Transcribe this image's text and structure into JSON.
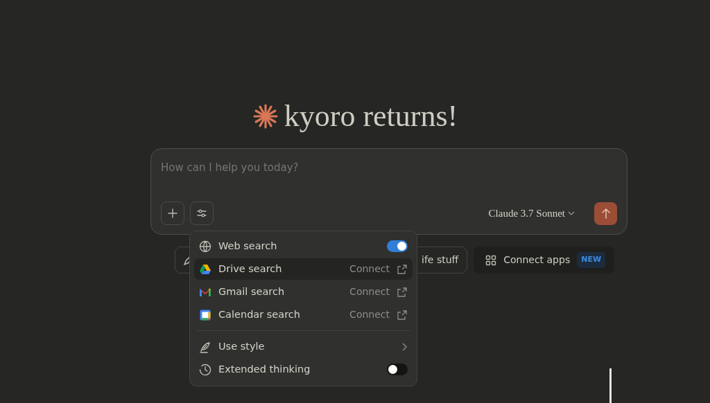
{
  "greeting": "kyoro returns!",
  "composer": {
    "placeholder": "How can I help you today?",
    "model": "Claude 3.7 Sonnet"
  },
  "chips": [
    {
      "label": "ife stuff",
      "kind": "plain"
    },
    {
      "label": "Connect apps",
      "badge": "NEW",
      "kind": "apps"
    }
  ],
  "menu": {
    "items": [
      {
        "kind": "toggle",
        "label": "Web search",
        "on": true,
        "selected": false
      },
      {
        "kind": "connect",
        "label": "Drive search",
        "action": "Connect",
        "selected": true
      },
      {
        "kind": "connect",
        "label": "Gmail search",
        "action": "Connect",
        "selected": false
      },
      {
        "kind": "connect",
        "label": "Calendar search",
        "action": "Connect",
        "selected": false
      },
      {
        "kind": "divider"
      },
      {
        "kind": "submenu",
        "label": "Use style",
        "selected": false
      },
      {
        "kind": "toggle",
        "label": "Extended thinking",
        "on": false,
        "selected": false
      }
    ]
  }
}
